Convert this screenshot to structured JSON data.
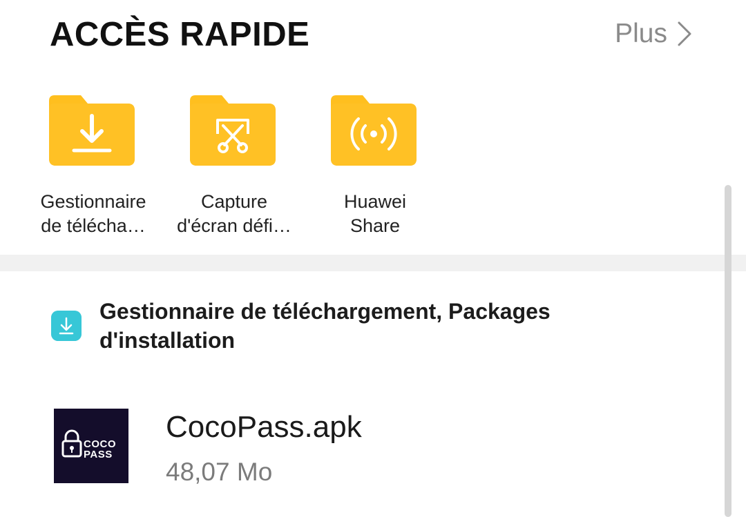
{
  "quick_access": {
    "title": "ACCÈS RAPIDE",
    "more_label": "Plus",
    "items": [
      {
        "label_line1": "Gestionnaire",
        "label_line2": "de télécha…",
        "icon": "download-folder-icon"
      },
      {
        "label_line1": "Capture",
        "label_line2": "d'écran défi…",
        "icon": "screenshot-folder-icon"
      },
      {
        "label_line1": "Huawei",
        "label_line2": "Share",
        "icon": "share-folder-icon"
      }
    ]
  },
  "recent_group": {
    "title": "Gestionnaire de téléchargement, Packages d'installation",
    "icon": "download-icon",
    "files": [
      {
        "name": "CocoPass.apk",
        "size": "48,07 Mo",
        "thumb_text_top": "COCO",
        "thumb_text_bottom": "PASS"
      }
    ]
  },
  "colors": {
    "folder": "#FFBF1F",
    "group_icon": "#37C7D7",
    "thumb_bg": "#140D2B",
    "accent_gray": "#8A8A8A"
  }
}
